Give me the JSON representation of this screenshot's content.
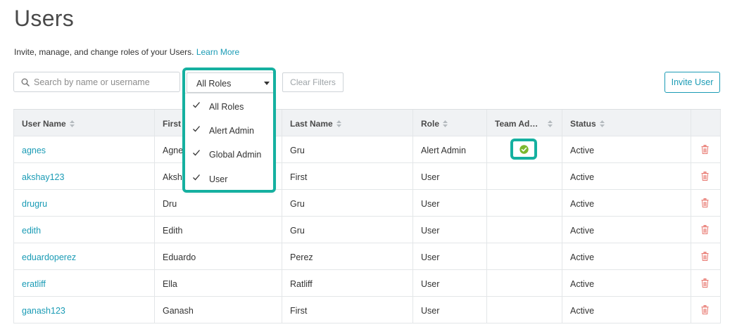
{
  "page": {
    "title": "Users",
    "subtitle": "Invite, manage, and change roles of your Users.",
    "learn_more": "Learn More"
  },
  "toolbar": {
    "search_placeholder": "Search by name or username",
    "role_filter_value": "All Roles",
    "clear_filters": "Clear Filters",
    "invite_user": "Invite User"
  },
  "role_dropdown": {
    "options": [
      "All Roles",
      "Alert Admin",
      "Global Admin",
      "User"
    ]
  },
  "table": {
    "columns": [
      "User Name",
      "First Name",
      "Last Name",
      "Role",
      "Team Ad…",
      "Status"
    ],
    "rows": [
      {
        "username": "agnes",
        "first": "Agnes",
        "last": "Gru",
        "role": "Alert Admin",
        "team_admin": true,
        "status": "Active"
      },
      {
        "username": "akshay123",
        "first": "Akshay",
        "last": "First",
        "role": "User",
        "team_admin": false,
        "status": "Active"
      },
      {
        "username": "drugru",
        "first": "Dru",
        "last": "Gru",
        "role": "User",
        "team_admin": false,
        "status": "Active"
      },
      {
        "username": "edith",
        "first": "Edith",
        "last": "Gru",
        "role": "User",
        "team_admin": false,
        "status": "Active"
      },
      {
        "username": "eduardoperez",
        "first": "Eduardo",
        "last": "Perez",
        "role": "User",
        "team_admin": false,
        "status": "Active"
      },
      {
        "username": "eratliff",
        "first": "Ella",
        "last": "Ratliff",
        "role": "User",
        "team_admin": false,
        "status": "Active"
      },
      {
        "username": "ganash123",
        "first": "Ganash",
        "last": "First",
        "role": "User",
        "team_admin": false,
        "status": "Active"
      }
    ]
  },
  "colors": {
    "accent": "#1a9bb5",
    "highlight": "#15b0a0",
    "delete": "#e8776f",
    "team_admin_check": "#7cb82f"
  }
}
